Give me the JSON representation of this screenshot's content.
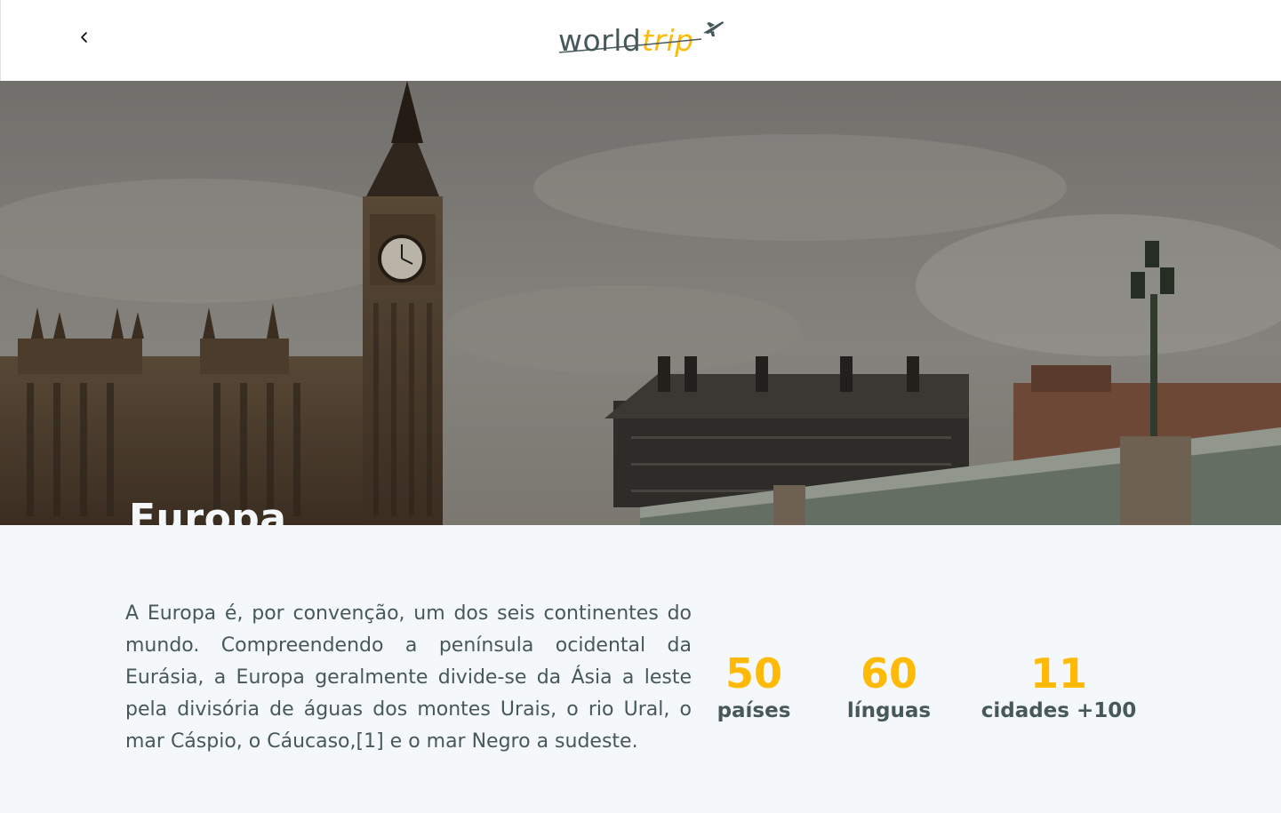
{
  "header": {
    "back_icon": "chevron-left-icon",
    "logo_world": "world",
    "logo_trip": "trip",
    "logo_icon": "airplane-icon"
  },
  "banner": {
    "title": "Europa"
  },
  "content": {
    "description": "A Europa é, por convenção, um dos seis continentes do mundo. Compreendendo a península ocidental da Eurásia, a Europa geralmente divide-se da Ásia a leste pela divisória de águas dos montes Urais, o rio Ural, o mar Cáspio, o Cáucaso,[1] e o mar Negro a sudeste."
  },
  "stats": [
    {
      "value": "50",
      "label": "países"
    },
    {
      "value": "60",
      "label": "línguas"
    },
    {
      "value": "11",
      "label": "cidades +100"
    }
  ],
  "colors": {
    "accent": "#ffba08",
    "text": "#47585b",
    "background": "#f5f8fa",
    "light_text": "#f5f8fa"
  }
}
